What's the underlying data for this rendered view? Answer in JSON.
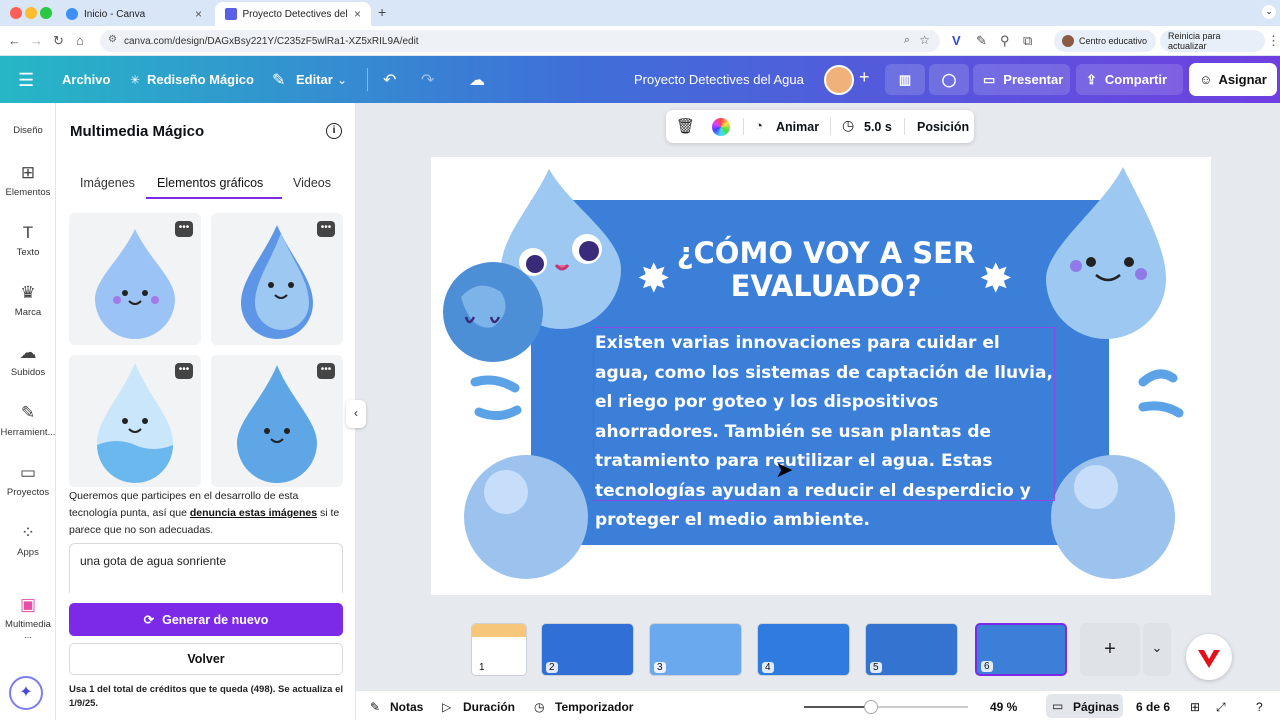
{
  "browser": {
    "tabs": [
      {
        "title": "Inicio - Canva"
      },
      {
        "title": "Proyecto Detectives del Agua"
      }
    ],
    "url": "canva.com/design/DAGxBsy221Y/C235zF5wlRa1-XZ5xRIL9A/edit",
    "profile_label": "Centro educativo",
    "update_label": "Reinicia para actualizar"
  },
  "toolbar": {
    "file": "Archivo",
    "magic_redesign": "Rediseño Mágico",
    "edit": "Editar",
    "project_title": "Proyecto Detectives del Agua",
    "present": "Presentar",
    "share": "Compartir",
    "assign": "Asignar"
  },
  "rail": {
    "items": [
      {
        "label": "Diseño",
        "icon": "design-icon"
      },
      {
        "label": "Elementos",
        "icon": "elements-icon"
      },
      {
        "label": "Texto",
        "icon": "text-icon"
      },
      {
        "label": "Marca",
        "icon": "brand-icon"
      },
      {
        "label": "Subidos",
        "icon": "cloud-upload-icon"
      },
      {
        "label": "Herramient...",
        "icon": "tools-icon"
      },
      {
        "label": "Proyectos",
        "icon": "folder-icon"
      },
      {
        "label": "Apps",
        "icon": "apps-icon"
      },
      {
        "label": "Multimedia ...",
        "icon": "magic-media-icon"
      }
    ]
  },
  "panel": {
    "title": "Multimedia Mágico",
    "tabs": [
      "Imágenes",
      "Elementos gráficos",
      "Videos"
    ],
    "active_tab": "Elementos gráficos",
    "notice_prefix": "Queremos que participes en el desarrollo de esta tecnología punta, así que ",
    "notice_link": "denuncia estas imágenes",
    "notice_suffix": " si te parece que no son adecuadas.",
    "prompt_value": "una gota de agua sonriente",
    "regenerate": "Generar de nuevo",
    "back": "Volver",
    "credits": "Usa 1 del total de créditos que te queda (498). Se actualiza el 1/9/25."
  },
  "float_toolbar": {
    "animate": "Animar",
    "duration": "5.0 s",
    "position": "Posición"
  },
  "slide": {
    "title_line1": "¿CÓMO VOY A SER",
    "title_line2": "EVALUADO?",
    "body": "Existen varias innovaciones para cuidar el agua, como los sistemas de captación de lluvia, el riego por goteo y los dispositivos ahorradores. También se usan plantas de tratamiento para reutilizar el agua. Estas tecnologías ayudan a reducir el desperdicio y proteger el medio ambiente."
  },
  "pages": {
    "thumbnails": [
      "1",
      "2",
      "3",
      "4",
      "5",
      "6"
    ],
    "active": 6
  },
  "bottombar": {
    "notes": "Notas",
    "duration": "Duración",
    "timer": "Temporizador",
    "zoom": "49 %",
    "pages": "Páginas",
    "page_count": "6 de 6"
  },
  "colors": {
    "slide_blue": "#3b7fd9",
    "accent_purple": "#7d2ae8",
    "drop_blue": "#9cc8f2"
  }
}
